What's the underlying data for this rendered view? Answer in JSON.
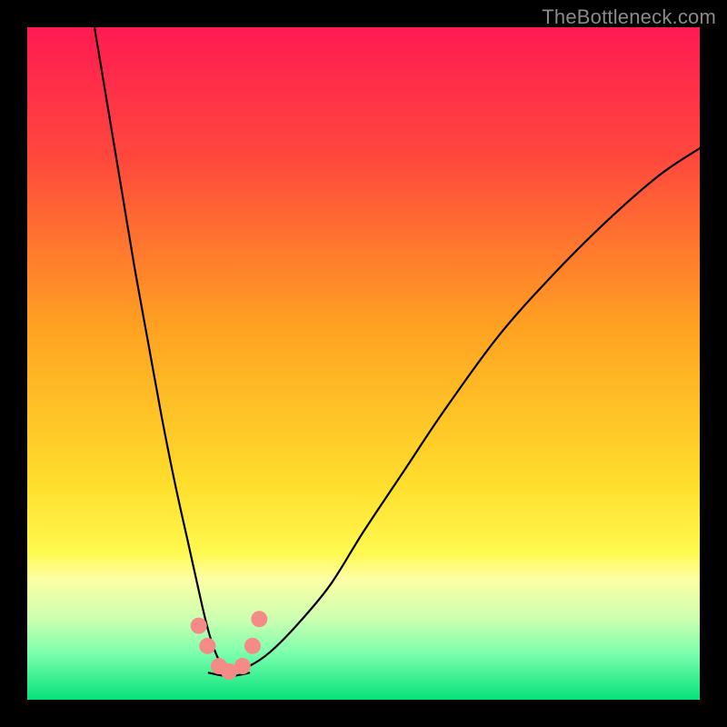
{
  "watermark": "TheBottleneck.com",
  "chart_data": {
    "type": "line",
    "title": "",
    "xlabel": "",
    "ylabel": "",
    "xlim": [
      0,
      100
    ],
    "ylim": [
      0,
      100
    ],
    "gradient_stops": [
      {
        "offset": 0.0,
        "color": "#ff1a52"
      },
      {
        "offset": 0.2,
        "color": "#ff4a3c"
      },
      {
        "offset": 0.45,
        "color": "#ffa321"
      },
      {
        "offset": 0.68,
        "color": "#ffde2c"
      },
      {
        "offset": 0.78,
        "color": "#fff94f"
      },
      {
        "offset": 0.82,
        "color": "#fdffa4"
      },
      {
        "offset": 0.88,
        "color": "#ccffb0"
      },
      {
        "offset": 0.93,
        "color": "#7dffad"
      },
      {
        "offset": 1.0,
        "color": "#05e27b"
      }
    ],
    "series": [
      {
        "name": "curve-left",
        "x": [
          10,
          12,
          14,
          16,
          18,
          20,
          22,
          24,
          26,
          27,
          28,
          29,
          30
        ],
        "values": [
          100,
          88,
          76,
          64,
          53,
          42,
          32,
          23,
          14,
          10,
          7,
          5,
          4
        ]
      },
      {
        "name": "curve-right",
        "x": [
          30,
          33,
          36,
          40,
          45,
          50,
          56,
          62,
          70,
          78,
          86,
          94,
          100
        ],
        "values": [
          4,
          5,
          7,
          11,
          17,
          25,
          34,
          43,
          54,
          63,
          71,
          78,
          82
        ]
      },
      {
        "name": "trough-flat",
        "x": [
          27,
          30,
          33
        ],
        "values": [
          4,
          3.5,
          4
        ]
      }
    ],
    "markers": {
      "name": "trough-markers",
      "x": [
        25.5,
        26.8,
        28.5,
        30.0,
        32.0,
        33.5,
        34.5
      ],
      "values": [
        11,
        8,
        5,
        4.2,
        5,
        8,
        12
      ],
      "color": "#f58b87",
      "radius_px": 9
    }
  }
}
